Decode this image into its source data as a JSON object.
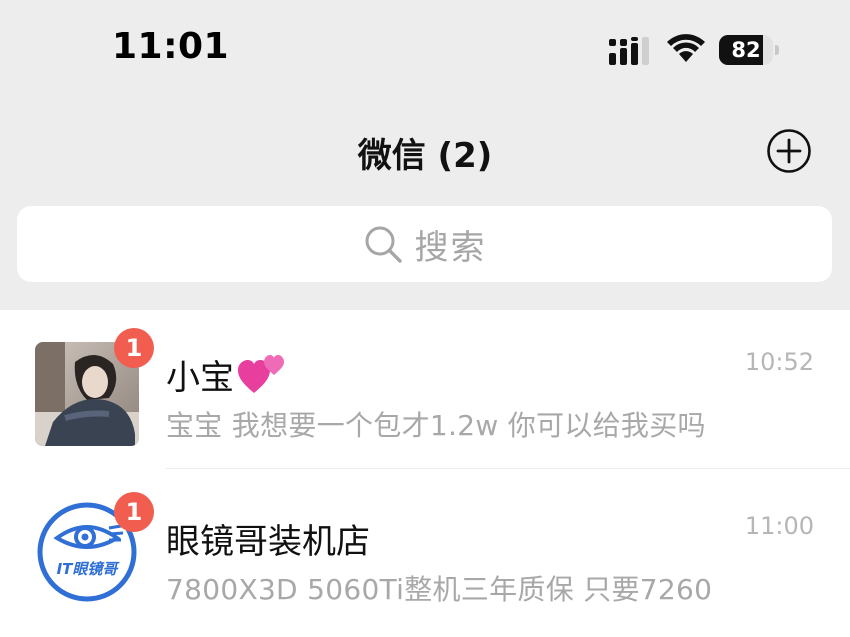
{
  "status_bar": {
    "time": "11:01",
    "battery": "82",
    "battery_level": 0.82
  },
  "nav": {
    "title": "微信 (2)",
    "add_icon": "plus-circle-icon"
  },
  "search": {
    "placeholder": "搜索",
    "icon": "search-icon"
  },
  "chats": [
    {
      "name": "小宝",
      "emoji": "💕",
      "message": "宝宝 我想要一个包才1.2w 你可以给我买吗",
      "time": "10:52",
      "unread": "1"
    },
    {
      "name": "眼镜哥装机店",
      "message": "7800X3D 5060Ti整机三年质保 只要7260",
      "time": "11:00",
      "unread": "1",
      "avatar_text": "IT眼镜哥"
    }
  ],
  "colors": {
    "background": "#ededed",
    "badge": "#f15d4f",
    "logo_blue": "#2f6fd6"
  }
}
